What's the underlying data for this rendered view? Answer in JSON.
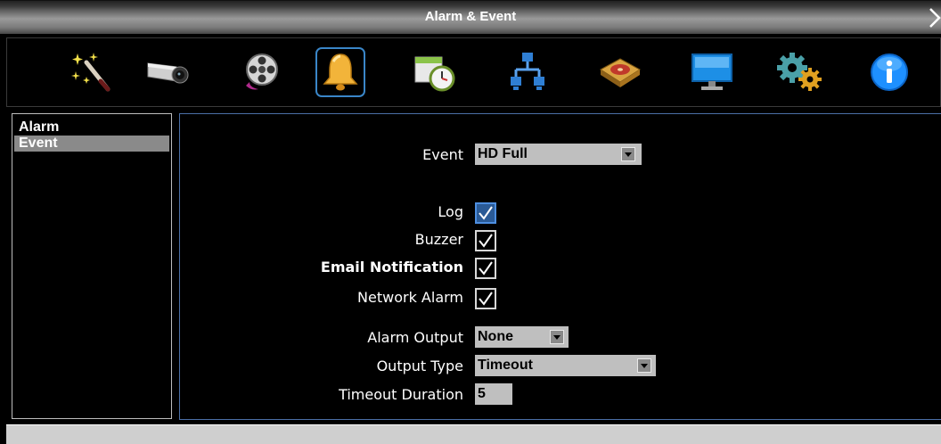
{
  "window": {
    "title": "Alarm & Event"
  },
  "toolbar": {
    "items": [
      {
        "icon": "wizard-wand-icon"
      },
      {
        "icon": "camera-icon"
      },
      {
        "icon": "film-reel-icon"
      },
      {
        "icon": "bell-icon",
        "active": true
      },
      {
        "icon": "schedule-clock-icon"
      },
      {
        "icon": "network-icon"
      },
      {
        "icon": "hard-disk-icon"
      },
      {
        "icon": "monitor-icon"
      },
      {
        "icon": "gears-icon"
      },
      {
        "icon": "info-icon"
      }
    ]
  },
  "sidebar": {
    "items": [
      {
        "label": "Alarm",
        "selected": false
      },
      {
        "label": "Event",
        "selected": true
      }
    ]
  },
  "form": {
    "event": {
      "label": "Event",
      "value": "HD Full"
    },
    "log": {
      "label": "Log",
      "checked": true
    },
    "buzzer": {
      "label": "Buzzer",
      "checked": true
    },
    "email_notification": {
      "label": "Email Notification",
      "checked": true
    },
    "network_alarm": {
      "label": "Network Alarm",
      "checked": true
    },
    "alarm_output": {
      "label": "Alarm Output",
      "value": "None"
    },
    "output_type": {
      "label": "Output Type",
      "value": "Timeout"
    },
    "timeout_duration": {
      "label": "Timeout Duration",
      "value": "5"
    }
  },
  "colors": {
    "accent": "#3a86c8",
    "panel_border": "#4b6fa6",
    "field_bg": "#bfbfbf",
    "selected_bg": "#8a8a8a"
  }
}
